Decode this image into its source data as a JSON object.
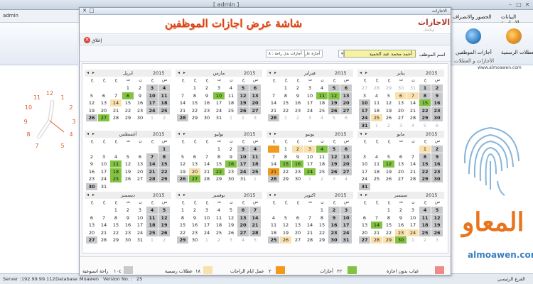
{
  "app": {
    "title": "[ admin ]",
    "version_label": "V5.1.6",
    "user": "admin",
    "menu_tabs": [
      "البيانات الاساسية",
      "الحضور والانصراف"
    ],
    "ribbon": {
      "holidays": "العطلات الرسمية",
      "emp_leaves": "أجازات الموظفين",
      "group": "الأجازات و العطلات"
    },
    "url": "www.almoawen.com",
    "logo_text": "المعاو",
    "logo_url": "almoawen.com",
    "status": {
      "server_label": "Server :",
      "server": "192.99.99.112",
      "database_label": "Database :",
      "db_name": "Moawen",
      "version_label": "Version No. :",
      "version_no": "25",
      "branch": "الفرع الرئيسي"
    },
    "clock_numbers": [
      "12",
      "1",
      "2",
      "3",
      "4",
      "5",
      "7",
      "8",
      "9",
      "10",
      "11"
    ]
  },
  "dialog": {
    "window_title": "الاجازات",
    "header_title": "شاشة عرض اجازات الموظفين",
    "header_logo": "الاجازات",
    "header_sub": "ويكسل",
    "close_label": "إغلاق",
    "filter": {
      "employee_label": "اسم الموظف",
      "employee_value": "أحمد محمد عبد الحميد",
      "leave_type1": "أجازة عارضة : ٢",
      "leave_type2": "أجازات بدل راحة : ٨"
    },
    "year": "2015",
    "dows": [
      "ج",
      "خ",
      "ع",
      "ث",
      "ن",
      "ح",
      "س"
    ],
    "colors": {
      "weekend": "#c8c9cb",
      "leave": "#82c341",
      "holiday": "#f9e1ad",
      "absence": "#ef8a86",
      "restday": "#f19a1c"
    },
    "months": [
      {
        "name": "يناير",
        "days": [
          [
            "27",
            "28",
            "29",
            "30",
            "31",
            "1",
            "2"
          ],
          [
            "3",
            "4",
            "5",
            "6",
            "7",
            "8",
            "9"
          ],
          [
            "10",
            "11",
            "12",
            "13",
            "14",
            "15",
            "16"
          ],
          [
            "17",
            "18",
            "19",
            "20",
            "21",
            "22",
            "23"
          ],
          [
            "24",
            "25",
            "26",
            "27",
            "28",
            "29",
            "30"
          ],
          [
            "31",
            "1",
            "2",
            "3",
            "4",
            "5",
            "6"
          ]
        ],
        "marks": {
          "0-5": "w",
          "0-6": "w",
          "1-3": "p",
          "1-4": "p",
          "1-5": "w",
          "1-6": "w",
          "2-0": "w",
          "2-5": "g",
          "2-6": "w",
          "3-0": "w",
          "3-5": "w",
          "3-6": "w",
          "4-0": "w",
          "4-1": "p",
          "4-5": "w",
          "4-6": "w",
          "5-0": "w"
        },
        "other": {
          "0-0": 1,
          "0-1": 1,
          "0-2": 1,
          "0-3": 1,
          "0-4": 1,
          "5-1": 1,
          "5-2": 1,
          "5-3": 1,
          "5-4": 1,
          "5-5": 1,
          "5-6": 1
        }
      },
      {
        "name": "فبراير",
        "days": [
          [
            "",
            "1",
            "2",
            "3",
            "4",
            "5",
            "6"
          ],
          [
            "7",
            "8",
            "9",
            "10",
            "11",
            "12",
            "13"
          ],
          [
            "14",
            "15",
            "16",
            "17",
            "18",
            "19",
            "20"
          ],
          [
            "21",
            "22",
            "23",
            "24",
            "25",
            "26",
            "27"
          ],
          [
            "28",
            "1",
            "2",
            "3",
            "4",
            "5",
            "6"
          ],
          [
            "",
            "",
            "",
            "",
            "",
            "",
            ""
          ]
        ],
        "marks": {
          "0-5": "w",
          "0-6": "w",
          "1-4": "g",
          "1-5": "g",
          "1-6": "w",
          "2-5": "w",
          "2-6": "w",
          "3-5": "w",
          "3-6": "w",
          "4-0": "w"
        },
        "other": {
          "4-1": 1,
          "4-2": 1,
          "4-3": 1,
          "4-4": 1,
          "4-5": 1,
          "4-6": 1
        }
      },
      {
        "name": "مارس",
        "days": [
          [
            "",
            "1",
            "2",
            "3",
            "4",
            "5",
            "6"
          ],
          [
            "7",
            "8",
            "9",
            "10",
            "11",
            "12",
            "13"
          ],
          [
            "14",
            "15",
            "16",
            "17",
            "18",
            "19",
            "20"
          ],
          [
            "21",
            "22",
            "23",
            "24",
            "25",
            "26",
            "27"
          ],
          [
            "28",
            "29",
            "30",
            "31",
            "1",
            "2",
            "3"
          ],
          [
            "",
            "",
            "",
            "",
            "",
            "",
            ""
          ]
        ],
        "marks": {
          "0-5": "w",
          "0-6": "w",
          "1-3": "g",
          "1-5": "w",
          "1-6": "w",
          "2-5": "w",
          "2-6": "w",
          "3-5": "w",
          "3-6": "w",
          "4-0": "w"
        },
        "other": {
          "4-4": 1,
          "4-5": 1,
          "4-6": 1
        }
      },
      {
        "name": "ابريل",
        "days": [
          [
            "",
            "",
            "",
            "1",
            "2",
            "3",
            "4"
          ],
          [
            "5",
            "6",
            "7",
            "8",
            "9",
            "10",
            "11"
          ],
          [
            "12",
            "13",
            "14",
            "15",
            "16",
            "17",
            "18"
          ],
          [
            "19",
            "20",
            "21",
            "22",
            "23",
            "24",
            "25"
          ],
          [
            "26",
            "27",
            "28",
            "29",
            "30",
            "1",
            "2"
          ],
          [
            "",
            "",
            "",
            "",
            "",
            "",
            ""
          ]
        ],
        "marks": {
          "0-5": "w",
          "0-6": "w",
          "1-3": "g",
          "1-5": "w",
          "1-6": "w",
          "2-2": "p",
          "2-5": "w",
          "2-6": "w",
          "3-5": "w",
          "3-6": "w",
          "4-0": "w",
          "4-1": "g"
        },
        "other": {
          "4-5": 1,
          "4-6": 1
        }
      },
      {
        "name": "مايو",
        "days": [
          [
            "",
            "",
            "",
            "",
            "",
            "1",
            "2"
          ],
          [
            "3",
            "4",
            "5",
            "6",
            "7",
            "8",
            "9"
          ],
          [
            "10",
            "11",
            "12",
            "13",
            "14",
            "15",
            "16"
          ],
          [
            "17",
            "18",
            "19",
            "20",
            "21",
            "22",
            "23"
          ],
          [
            "24",
            "25",
            "26",
            "27",
            "28",
            "29",
            "30"
          ],
          [
            "31",
            "",
            "",
            "",
            "",
            "",
            ""
          ]
        ],
        "marks": {
          "0-5": "p",
          "0-6": "w",
          "1-5": "w",
          "1-6": "w",
          "2-2": "g",
          "2-5": "w",
          "2-6": "w",
          "3-5": "w",
          "3-6": "w",
          "4-5": "w",
          "4-6": "w",
          "5-0": "w"
        },
        "other": {}
      },
      {
        "name": "يونيو",
        "days": [
          [
            "",
            "1",
            "2",
            "3",
            "4",
            "5",
            "6"
          ],
          [
            "7",
            "8",
            "9",
            "10",
            "11",
            "12",
            "13"
          ],
          [
            "14",
            "15",
            "16",
            "17",
            "18",
            "19",
            "20"
          ],
          [
            "21",
            "22",
            "23",
            "24",
            "25",
            "26",
            "27"
          ],
          [
            "28",
            "29",
            "30",
            "1",
            "2",
            "3",
            "4"
          ],
          [
            "",
            "",
            "",
            "",
            "",
            "",
            ""
          ]
        ],
        "marks": {
          "0-0": "s",
          "0-2": "p",
          "0-3": "p",
          "0-4": "g",
          "0-5": "w",
          "0-6": "w",
          "1-5": "w",
          "1-6": "w",
          "2-1": "g",
          "2-2": "g",
          "2-5": "w",
          "2-6": "w",
          "3-5": "w",
          "3-6": "w",
          "3-0": "s",
          "3-3": "g",
          "4-0": "w"
        },
        "other": {
          "4-3": 1,
          "4-4": 1,
          "4-5": 1,
          "4-6": 1
        }
      },
      {
        "name": "يوليو",
        "days": [
          [
            "",
            "",
            "",
            "1",
            "2",
            "3",
            "4"
          ],
          [
            "5",
            "6",
            "7",
            "8",
            "9",
            "10",
            "11"
          ],
          [
            "12",
            "13",
            "14",
            "15",
            "16",
            "17",
            "18"
          ],
          [
            "19",
            "20",
            "21",
            "22",
            "23",
            "24",
            "25"
          ],
          [
            "26",
            "27",
            "28",
            "29",
            "30",
            "31",
            "1"
          ],
          [
            "",
            "",
            "",
            "",
            "",
            "",
            ""
          ]
        ],
        "marks": {
          "0-5": "w",
          "0-6": "w",
          "1-5": "w",
          "1-6": "w",
          "2-4": "g",
          "2-5": "w",
          "2-6": "w",
          "3-1": "p",
          "3-3": "g",
          "3-5": "w",
          "3-6": "w",
          "4-0": "w",
          "4-1": "g"
        },
        "other": {
          "4-6": 1
        }
      },
      {
        "name": "أغسطس",
        "days": [
          [
            "",
            "",
            "",
            "",
            "",
            "",
            "1"
          ],
          [
            "2",
            "3",
            "4",
            "5",
            "6",
            "7",
            "8"
          ],
          [
            "9",
            "10",
            "11",
            "12",
            "13",
            "14",
            "15"
          ],
          [
            "16",
            "17",
            "18",
            "19",
            "20",
            "21",
            "22"
          ],
          [
            "23",
            "24",
            "25",
            "26",
            "27",
            "28",
            "29"
          ],
          [
            "30",
            "31",
            "",
            "",
            "",
            "",
            ""
          ]
        ],
        "marks": {
          "0-6": "w",
          "1-5": "w",
          "1-6": "w",
          "2-2": "g",
          "2-5": "w",
          "2-6": "w",
          "3-2": "g",
          "3-5": "w",
          "3-6": "w",
          "4-2": "g",
          "4-5": "w",
          "4-6": "w",
          "5-0": "w"
        },
        "other": {}
      },
      {
        "name": "سبتمبر",
        "days": [
          [
            "",
            "",
            "1",
            "2",
            "3",
            "4",
            "5"
          ],
          [
            "6",
            "7",
            "8",
            "9",
            "10",
            "11",
            "12"
          ],
          [
            "13",
            "14",
            "15",
            "16",
            "17",
            "18",
            "19"
          ],
          [
            "20",
            "21",
            "22",
            "23",
            "24",
            "25",
            "26"
          ],
          [
            "27",
            "28",
            "29",
            "30",
            "1",
            "2",
            "3"
          ],
          [
            "",
            "",
            "",
            "",
            "",
            "",
            ""
          ]
        ],
        "marks": {
          "0-5": "w",
          "0-6": "w",
          "1-5": "w",
          "1-6": "w",
          "2-1": "g",
          "2-5": "w",
          "2-6": "w",
          "3-3": "p",
          "3-4": "p",
          "3-5": "w",
          "3-6": "w",
          "4-0": "w",
          "4-1": "p",
          "4-2": "p",
          "4-3": "g"
        },
        "other": {
          "4-4": 1,
          "4-5": 1,
          "4-6": 1
        }
      },
      {
        "name": "اكتوبر",
        "days": [
          [
            "",
            "",
            "",
            "",
            "1",
            "2",
            "3"
          ],
          [
            "4",
            "5",
            "6",
            "7",
            "8",
            "9",
            "10"
          ],
          [
            "11",
            "12",
            "13",
            "14",
            "15",
            "16",
            "17"
          ],
          [
            "18",
            "19",
            "20",
            "21",
            "22",
            "23",
            "24"
          ],
          [
            "25",
            "26",
            "27",
            "28",
            "29",
            "30",
            "31"
          ],
          [
            "",
            "",
            "",
            "",
            "",
            "",
            ""
          ]
        ],
        "marks": {
          "0-5": "w",
          "0-6": "w",
          "1-5": "w",
          "1-6": "w",
          "2-5": "w",
          "2-6": "w",
          "3-5": "w",
          "3-6": "w",
          "4-0": "w",
          "4-5": "w",
          "4-6": "w",
          "4-1": "p"
        },
        "other": {}
      },
      {
        "name": "نوفمبر",
        "days": [
          [
            "1",
            "2",
            "3",
            "4",
            "5",
            "6",
            "7"
          ],
          [
            "8",
            "9",
            "10",
            "11",
            "12",
            "13",
            "14"
          ],
          [
            "15",
            "16",
            "17",
            "18",
            "19",
            "20",
            "21"
          ],
          [
            "22",
            "23",
            "24",
            "25",
            "26",
            "27",
            "28"
          ],
          [
            "29",
            "30",
            "1",
            "2",
            "3",
            "4",
            "5"
          ],
          [
            "",
            "",
            "",
            "",
            "",
            "",
            ""
          ]
        ],
        "marks": {
          "0-5": "w",
          "0-6": "w",
          "1-5": "w",
          "1-6": "w",
          "2-5": "w",
          "2-6": "w",
          "3-5": "w",
          "3-6": "w",
          "4-0": "w"
        },
        "other": {
          "4-2": 1,
          "4-3": 1,
          "4-4": 1,
          "4-5": 1,
          "4-6": 1
        }
      },
      {
        "name": "ديسمبر",
        "days": [
          [
            "",
            "",
            "1",
            "2",
            "3",
            "4",
            "5"
          ],
          [
            "6",
            "7",
            "8",
            "9",
            "10",
            "11",
            "12"
          ],
          [
            "13",
            "14",
            "15",
            "16",
            "17",
            "18",
            "19"
          ],
          [
            "20",
            "21",
            "22",
            "23",
            "24",
            "25",
            "26"
          ],
          [
            "27",
            "28",
            "29",
            "30",
            "31",
            "1",
            "2"
          ],
          [
            "",
            "",
            "",
            "",
            "",
            "",
            ""
          ]
        ],
        "marks": {
          "0-5": "w",
          "0-6": "w",
          "1-5": "w",
          "1-6": "w",
          "2-5": "w",
          "2-6": "w",
          "3-5": "w",
          "3-6": "w",
          "4-0": "w"
        },
        "other": {
          "4-5": 1,
          "4-6": 1
        }
      }
    ],
    "legend": [
      {
        "key": "absence",
        "text": "غياب بدون اجازة",
        "count": ""
      },
      {
        "key": "leave",
        "text": "أجازات",
        "count": "٢٢"
      },
      {
        "key": "restday",
        "text": "عمل ايام الراحات",
        "count": "٢"
      },
      {
        "key": "holiday",
        "text": "عطلات رسمية",
        "count": "١٨"
      },
      {
        "key": "weekend",
        "text": "راحة اسبوعية",
        "count": "١٠٤"
      }
    ]
  }
}
